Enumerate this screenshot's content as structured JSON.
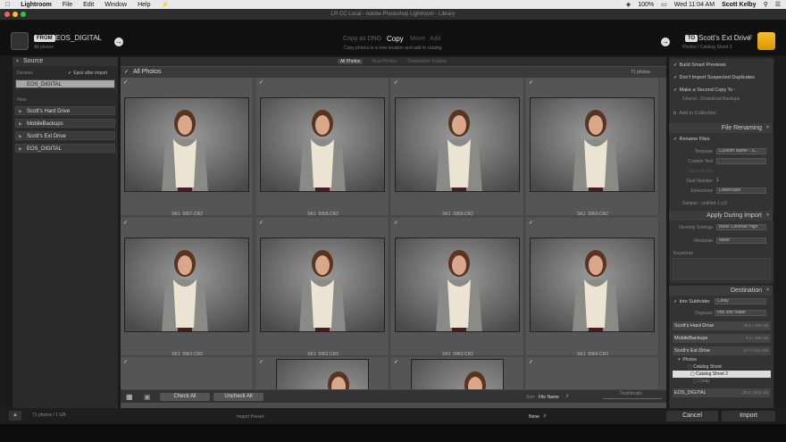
{
  "menubar": {
    "app": "Lightroom",
    "items": [
      "File",
      "Edit",
      "Window",
      "Help"
    ],
    "battery": "100%",
    "clock": "Wed 11:04 AM",
    "user": "Scott Kelby"
  },
  "window": {
    "title": "LR CC Local - Adobe Photoshop Lightroom - Library"
  },
  "topbar": {
    "from_badge": "FROM",
    "source_name": "EOS_DIGITAL",
    "source_sub": "All photos",
    "modes": [
      "Copy as DNG",
      "Copy",
      "Move",
      "Add"
    ],
    "active_mode": "Copy",
    "mode_desc": "Copy photos to a new location and add to catalog",
    "to_badge": "TO",
    "dest_name": "Scott's Ext Drive",
    "dest_sub": "Photos / Catalog Shoot 2"
  },
  "source_panel": {
    "header": "Source",
    "devices_label": "Devices",
    "eject_label": "Eject after import",
    "device": "EOS_DIGITAL",
    "files_label": "Files",
    "drives": [
      "Scott's Hard Drive",
      "MobileBackups",
      "Scott's Ext Drive",
      "EOS_DIGITAL"
    ]
  },
  "grid": {
    "tabs": [
      "All Photos",
      "New Photos",
      "Destination Folders"
    ],
    "active_tab": "All Photos",
    "header": "All Photos",
    "count": "71 photos",
    "filenames": [
      "SK1_5957.CR2",
      "SK1_5958.CR2",
      "SK1_5959.CR2",
      "SK1_5960.CR2",
      "SK1_5961.CR2",
      "SK1_5962.CR2",
      "SK1_5963.CR2",
      "SK1_5964.CR2"
    ],
    "check_all": "Check All",
    "uncheck_all": "Uncheck All",
    "sort_label": "Sort:",
    "sort_value": "File Name",
    "thumbnails_label": "Thumbnails"
  },
  "right_panel": {
    "build_smart": "Build Smart Previews",
    "dont_import": "Don't Import Suspected Duplicates",
    "second_copy": "Make a Second Copy To :",
    "second_copy_path": "/Users/.../Download Backups",
    "add_collection": "Add to Collection",
    "file_renaming": {
      "header": "File Renaming",
      "rename": "Rename Files",
      "template_label": "Template",
      "template_value": "Custom Name - S...",
      "custom_text_label": "Custom Text",
      "shoot_name_label": "Shoot Name",
      "start_number_label": "Start Number",
      "start_number": "1",
      "extensions_label": "Extensions",
      "extensions_value": "Lowercase",
      "sample": "Sample : untitled-1.cr2"
    },
    "apply": {
      "header": "Apply During Import",
      "develop_label": "Develop Settings",
      "develop_value": "B&W Contrast High",
      "metadata_label": "Metadata",
      "metadata_value": "None",
      "keywords_label": "Keywords"
    },
    "destination": {
      "header": "Destination",
      "into_subfolder": "Into Subfolder",
      "subfolder_name": "Cindy",
      "organize_label": "Organize",
      "organize_value": "Into one folder",
      "drives": [
        {
          "name": "Scott's Hard Drive",
          "cap": "75.2 / 499 GB"
        },
        {
          "name": "MobileBackups",
          "cap": "0.0 / 499 GB"
        },
        {
          "name": "Scott's Ext Drive",
          "cap": "47.7 / 931 GB"
        }
      ],
      "folders": [
        "Photos",
        "Catalog Shoot",
        "Catalog Shoot 2",
        "Cindy"
      ],
      "last_drive": {
        "name": "EOS_DIGITAL",
        "cap": "28.3 / 29.8 GB"
      }
    }
  },
  "bottom": {
    "status": "71 photos / 1 GB",
    "preset_label": "Import Preset :",
    "preset_value": "None",
    "cancel": "Cancel",
    "import": "Import"
  },
  "colors": {
    "accent": "#e8a600",
    "dest_drive": "#e8a600"
  }
}
